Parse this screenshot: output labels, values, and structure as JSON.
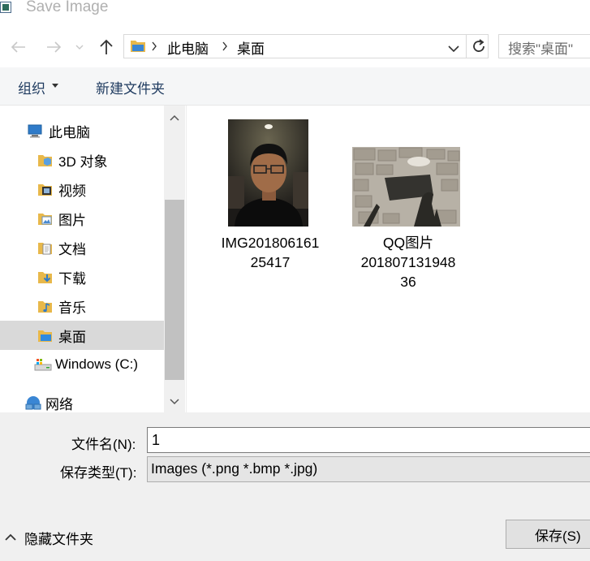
{
  "window": {
    "title": "Save Image"
  },
  "address": {
    "breadcrumbs": [
      "此电脑",
      "桌面"
    ],
    "search_placeholder": "搜索\"桌面\""
  },
  "toolbar": {
    "organize": "组织",
    "new_folder": "新建文件夹"
  },
  "nav": {
    "items": [
      {
        "label": "此电脑",
        "icon": "computer-icon"
      },
      {
        "label": "3D 对象",
        "icon": "3d-objects-folder-icon"
      },
      {
        "label": "视频",
        "icon": "videos-folder-icon"
      },
      {
        "label": "图片",
        "icon": "pictures-folder-icon"
      },
      {
        "label": "文档",
        "icon": "documents-folder-icon"
      },
      {
        "label": "下载",
        "icon": "downloads-folder-icon"
      },
      {
        "label": "音乐",
        "icon": "music-folder-icon"
      },
      {
        "label": "桌面",
        "icon": "desktop-folder-icon",
        "selected": true
      },
      {
        "label": "Windows (C:)",
        "icon": "drive-icon"
      },
      {
        "label": "网络",
        "icon": "network-icon"
      }
    ]
  },
  "files": [
    {
      "name_line1": "IMG201806161",
      "name_line2": "25417",
      "name_line3": ""
    },
    {
      "name_line1": "QQ图片",
      "name_line2": "201807131948",
      "name_line3": "36"
    }
  ],
  "form": {
    "filename_label": "文件名(N):",
    "filename_value": "1",
    "filetype_label": "保存类型(T):",
    "filetype_value": "Images (*.png *.bmp *.jpg)"
  },
  "footer": {
    "hide_folders": "隐藏文件夹",
    "save": "保存(S)"
  },
  "colors": {
    "selection": "#d9d9d9",
    "bottom_panel": "#f0f0f0",
    "folder_yellow": "#e8b84a"
  }
}
